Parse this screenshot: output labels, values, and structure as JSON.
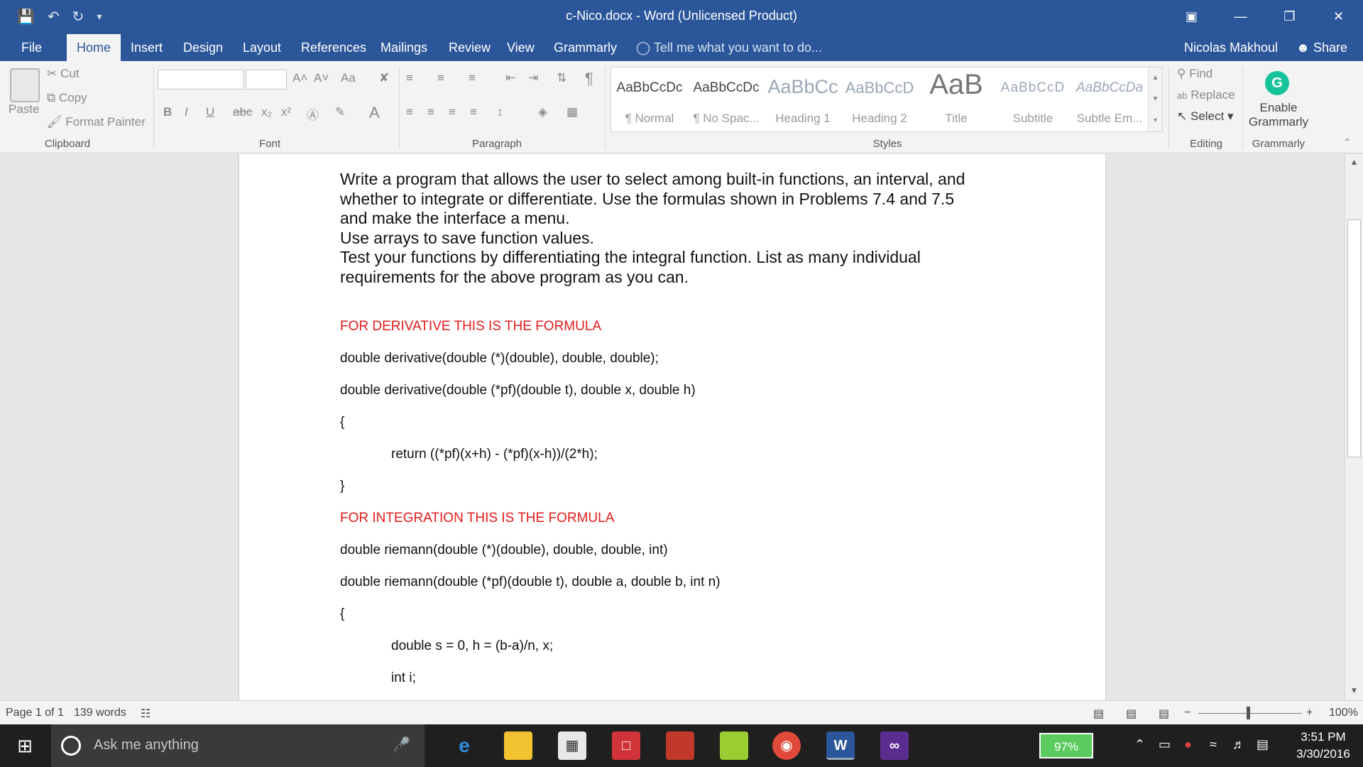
{
  "window": {
    "title": "c-Nico.docx - Word (Unlicensed Product)",
    "quick_access": [
      "save-icon",
      "undo-icon",
      "redo-icon",
      "customize-icon"
    ],
    "controls": [
      "ribbon-display-icon",
      "minimize-icon",
      "restore-icon",
      "close-icon"
    ]
  },
  "tabs": [
    "File",
    "Home",
    "Insert",
    "Design",
    "Layout",
    "References",
    "Mailings",
    "Review",
    "View",
    "Grammarly"
  ],
  "active_tab": "Home",
  "tell_me": "Tell me what you want to do...",
  "user": "Nicolas Makhoul",
  "share": "Share",
  "ribbon": {
    "clipboard": {
      "label": "Clipboard",
      "paste": "Paste",
      "cut": "Cut",
      "copy": "Copy",
      "format_painter": "Format Painter"
    },
    "font": {
      "label": "Font",
      "grow": "A˄",
      "shrink": "A˅",
      "case": "Aa",
      "bold": "B",
      "italic": "I",
      "underline": "U",
      "strike": "abc",
      "sub": "x₂",
      "sup": "x²"
    },
    "paragraph": {
      "label": "Paragraph"
    },
    "styles": {
      "label": "Styles",
      "items": [
        {
          "preview": "AaBbCcDc",
          "name": "¶ Normal"
        },
        {
          "preview": "AaBbCcDc",
          "name": "¶ No Spac..."
        },
        {
          "preview": "AaBbCc",
          "name": "Heading 1"
        },
        {
          "preview": "AaBbCcD",
          "name": "Heading 2"
        },
        {
          "preview": "AaB",
          "name": "Title"
        },
        {
          "preview": "AaBbCcD",
          "name": "Subtitle"
        },
        {
          "preview": "AaBbCcDa",
          "name": "Subtle Em..."
        }
      ]
    },
    "editing": {
      "label": "Editing",
      "find": "Find",
      "replace": "Replace",
      "select": "Select"
    },
    "grammarly": {
      "label": "Grammarly",
      "enable_line1": "Enable",
      "enable_line2": "Grammarly",
      "icon": "G"
    }
  },
  "document": {
    "intro_lines": [
      "Write a program that allows the user to select among built-in functions, an interval, and",
      "whether to integrate or differentiate. Use the formulas shown in Problems 7.4 and 7.5",
      "and make the interface a menu.",
      "Use arrays to save function values.",
      "Test your functions by differentiating the integral function.  List as many individual",
      "requirements for the above program as you can."
    ],
    "derivative_heading": "FOR DERIVATIVE THIS IS THE FORMULA",
    "derivative_code": [
      "double derivative(double (*)(double), double, double);",
      "double derivative(double (*pf)(double t), double x, double h)",
      "{",
      "return ((*pf)(x+h) - (*pf)(x-h))/(2*h);",
      "}"
    ],
    "integration_heading": "FOR INTEGRATION THIS IS THE FORMULA",
    "integration_code": [
      "double riemann(double (*)(double), double, double, int)",
      "double riemann(double (*pf)(double t), double a, double b, int n)",
      "{",
      "double s = 0, h = (b-a)/n, x;",
      "int i;"
    ]
  },
  "status": {
    "page": "Page 1 of 1",
    "words": "139 words",
    "zoom": "100%",
    "zoom_level_percent": 100
  },
  "taskbar": {
    "search_placeholder": "Ask me anything",
    "battery": "97%",
    "time": "3:51 PM",
    "date": "3/30/2016"
  }
}
